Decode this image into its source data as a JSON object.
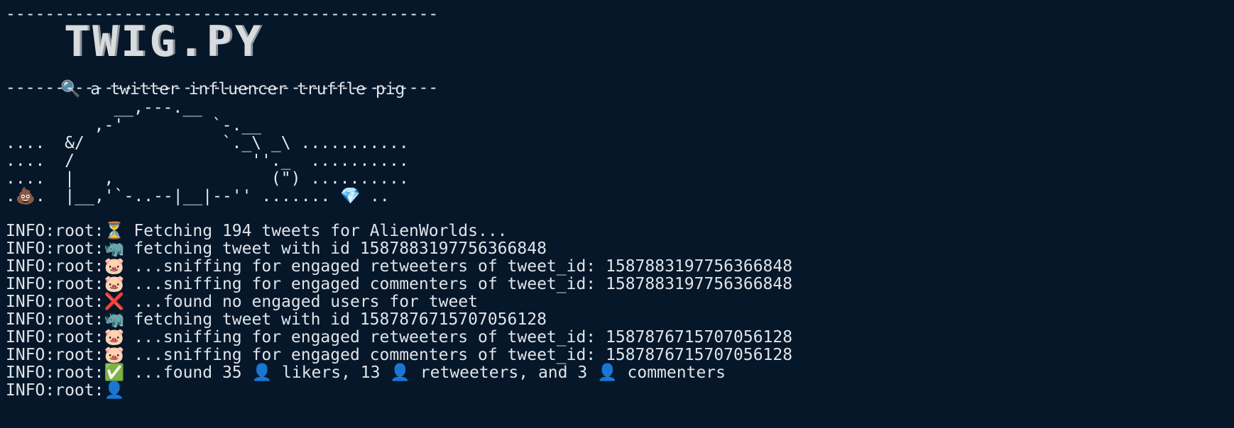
{
  "terminal": {
    "rule_top": "--------------------------------------------",
    "banner_title": "TWIG.PY",
    "subtitle_icon": "🔍",
    "subtitle": "a twitter influencer truffle pig",
    "rule_bottom": "--------------------------------------------",
    "ascii_art": [
      "           __,---.__",
      "         ,-'         `-.__",
      "....  &/              `._\\ _\\ ...........",
      "....  /                  ''._  ..........",
      "....  |   ,                (\") ..........",
      "   .  |__,'`-..--|__|--''  ....... ",
      ".. "
    ],
    "ascii_poop_prefix": ".",
    "ascii_poop_icon": "💩",
    "ascii_last_mid": ".  |__,'`-..--|__|--'' ....... ",
    "ascii_gem_icon": "💎",
    "ascii_last_tail": " ..",
    "log_lines": [
      {
        "prefix": "INFO:root:",
        "icon": "⏳",
        "text": " Fetching 194 tweets for AlienWorlds..."
      },
      {
        "prefix": "INFO:root:",
        "icon": "🦏",
        "text": " fetching tweet with id 1587883197756366848"
      },
      {
        "prefix": "INFO:root:",
        "icon": "🐷",
        "text": " ...sniffing for engaged retweeters of tweet_id: 1587883197756366848"
      },
      {
        "prefix": "INFO:root:",
        "icon": "🐷",
        "text": " ...sniffing for engaged commenters of tweet_id: 1587883197756366848"
      },
      {
        "prefix": "INFO:root:",
        "icon": "❌",
        "text": " ...found no engaged users for tweet"
      },
      {
        "prefix": "INFO:root:",
        "icon": "🦏",
        "text": " fetching tweet with id 1587876715707056128"
      },
      {
        "prefix": "INFO:root:",
        "icon": "🐷",
        "text": " ...sniffing for engaged retweeters of tweet_id: 1587876715707056128"
      },
      {
        "prefix": "INFO:root:",
        "icon": "🐷",
        "text": " ...sniffing for engaged commenters of tweet_id: 1587876715707056128"
      },
      {
        "prefix": "INFO:root:",
        "icon": "✅",
        "text": " ...found 35 👤 likers, 13 👤 retweeters, and 3 👤 commenters"
      },
      {
        "prefix": "INFO:root:",
        "icon": "👤",
        "text": " "
      }
    ]
  }
}
